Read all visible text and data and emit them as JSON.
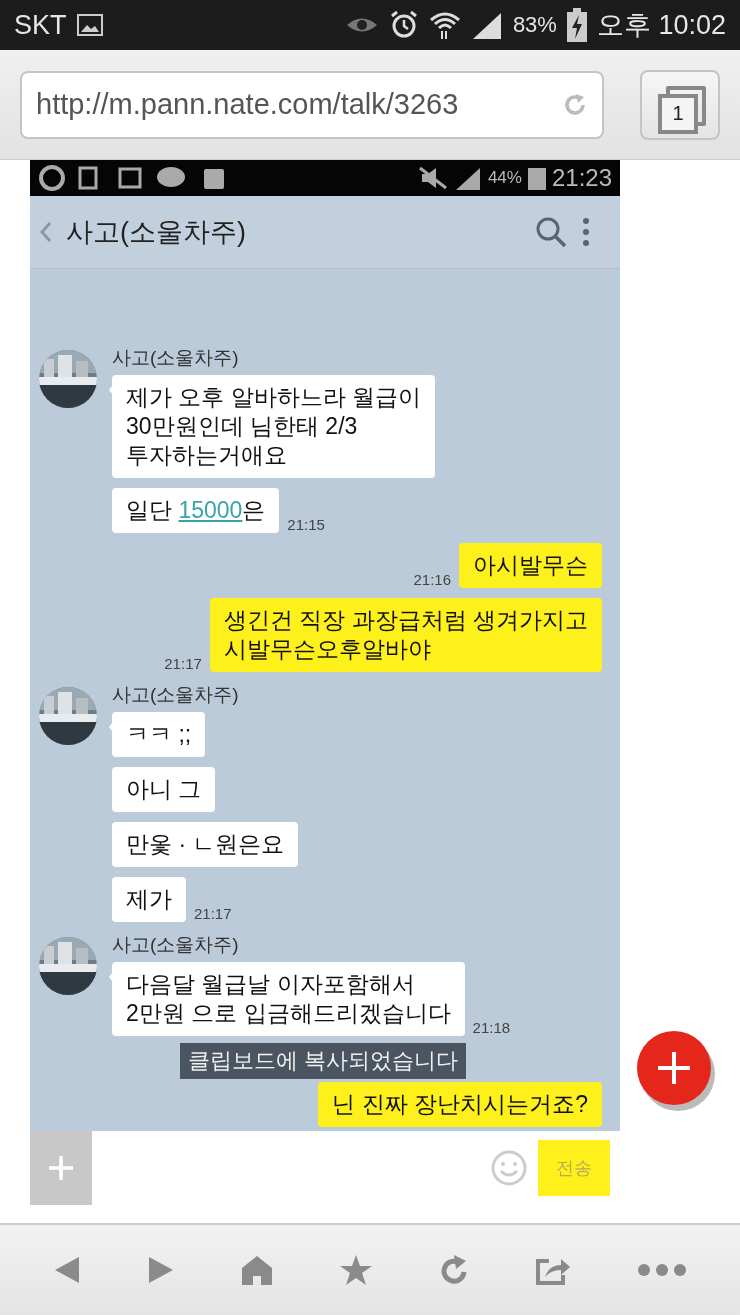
{
  "status_bar": {
    "carrier": "SKT",
    "battery": "83%",
    "time": "오후 10:02"
  },
  "browser": {
    "url": "http://m.pann.nate.com/talk/3263",
    "tab_count": "1"
  },
  "chat": {
    "status_bar": {
      "battery": "44%",
      "time": "21:23"
    },
    "title": "사고(소울차주)",
    "messages": [
      {
        "kind": "incoming",
        "sender": "사고(소울차주)",
        "time": "21:15",
        "bubbles": [
          {
            "segments": [
              {
                "kind": "text",
                "text": "제가 오후 알바하느라 월급이\n30만원인데 님한태 2/3\n투자하는거애요"
              }
            ]
          },
          {
            "segments": [
              {
                "kind": "text",
                "text": "일단 "
              },
              {
                "kind": "link",
                "text": "15000"
              },
              {
                "kind": "text",
                "text": "은"
              }
            ]
          }
        ]
      },
      {
        "kind": "outgoing",
        "time": "21:16",
        "text": "아시발무슨"
      },
      {
        "kind": "outgoing",
        "time": "21:17",
        "text": "생긴건 직장 과장급처럼 생겨가지고\n시발무슨오후알바야"
      },
      {
        "kind": "incoming",
        "sender": "사고(소울차주)",
        "time": "21:17",
        "bubbles": [
          {
            "segments": [
              {
                "kind": "text",
                "text": "ㅋㅋ ;;"
              }
            ]
          },
          {
            "segments": [
              {
                "kind": "text",
                "text": "아니 그"
              }
            ]
          },
          {
            "segments": [
              {
                "kind": "text",
                "text": "만옻 · ㄴ원은요"
              }
            ]
          },
          {
            "segments": [
              {
                "kind": "text",
                "text": "제가"
              }
            ]
          }
        ]
      },
      {
        "kind": "incoming",
        "sender": "사고(소울차주)",
        "time": "21:18",
        "bubbles": [
          {
            "segments": [
              {
                "kind": "text",
                "text": "다음달 월급날 이자포함해서\n2만원 으로 입금해드리겠습니다"
              }
            ]
          }
        ]
      },
      {
        "kind": "outgoing",
        "text": "닌 진짜 장난치시는거죠?"
      }
    ],
    "toast": "클립보드에 복사되었습니다",
    "send_button": {
      "label": "전송",
      "disabled": true
    }
  }
}
